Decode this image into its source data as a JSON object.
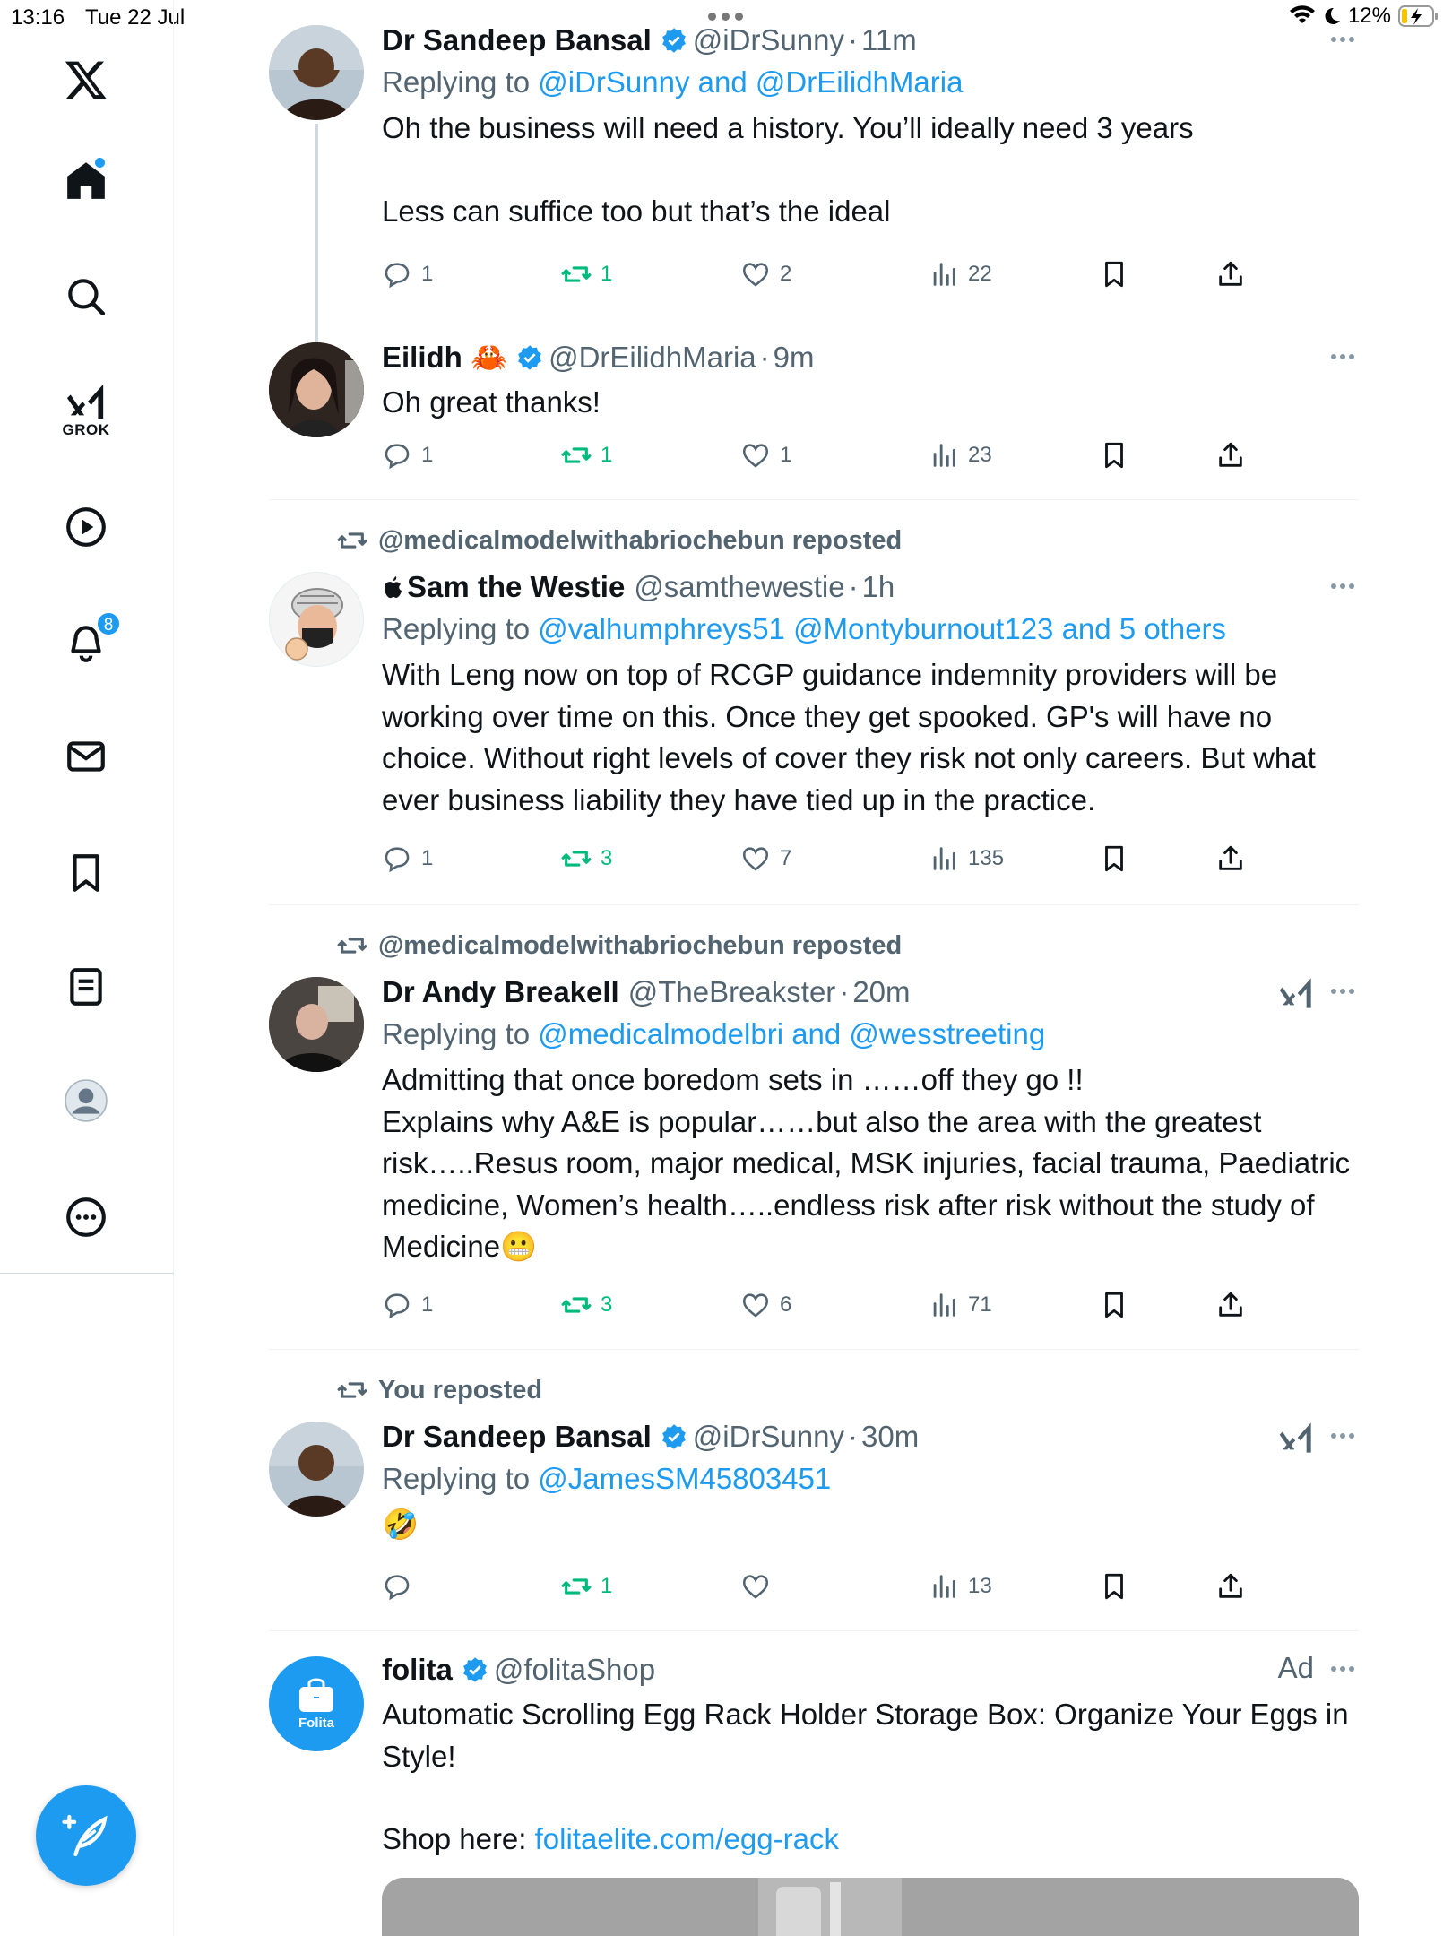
{
  "status_bar": {
    "time": "13:16",
    "date": "Tue 22 Jul",
    "battery": "12%"
  },
  "sidebar": {
    "grok_label": "GROK",
    "notifications_count": "8"
  },
  "tweets": [
    {
      "name": "Dr Sandeep Bansal",
      "handle": "@iDrSunny",
      "time": "11m",
      "replying_prefix": "Replying to ",
      "replying_to": "@iDrSunny and @DrEilidhMaria",
      "text_1": "Oh the business will need a history. You’ll ideally need 3 years",
      "text_2": "Less can suffice too but that’s the ideal",
      "replies": "1",
      "reposts": "1",
      "likes": "2",
      "views": "22"
    },
    {
      "name": "Eilidh 🦀",
      "handle": "@DrEilidhMaria",
      "time": "9m",
      "text_1": "Oh great thanks!",
      "replies": "1",
      "reposts": "1",
      "likes": "1",
      "views": "23"
    },
    {
      "reposted_by": "@medicalmodelwithabriochebun reposted",
      "name": " Sam the Westie",
      "handle": "@samthewestie",
      "time": "1h",
      "replying_prefix": "Replying to ",
      "replying_to": "@valhumphreys51 @Montyburnout123 and 5 others",
      "text_1": "With Leng now on top of RCGP guidance indemnity providers will be working over time on this. Once they get spooked. GP's will have no choice. Without right levels of cover they risk not only careers. But what ever business liability they have tied up in the practice.",
      "replies": "1",
      "reposts": "3",
      "likes": "7",
      "views": "135"
    },
    {
      "reposted_by": "@medicalmodelwithabriochebun reposted",
      "name": "Dr Andy Breakell",
      "handle": "@TheBreakster",
      "time": "20m",
      "replying_prefix": "Replying to ",
      "replying_to": "@medicalmodelbri and @wesstreeting",
      "text_1": "Admitting that once boredom sets in ……off they go !!",
      "text_2": "Explains why A&E is popular……but also the area with the greatest risk…..Resus room, major medical, MSK injuries, facial trauma, Paediatric medicine, Women’s health…..endless risk after risk without the study of Medicine😬",
      "replies": "1",
      "reposts": "3",
      "likes": "6",
      "views": "71"
    },
    {
      "reposted_by": "You reposted",
      "name": "Dr Sandeep Bansal",
      "handle": "@iDrSunny",
      "time": "30m",
      "replying_prefix": "Replying to ",
      "replying_to": "@JamesSM45803451",
      "text_1": "🤣",
      "replies": "",
      "reposts": "1",
      "likes": "",
      "views": "13"
    },
    {
      "name": "folita",
      "handle": "@folitaShop",
      "ad_label": "Ad",
      "avatar_text": "Folita",
      "text_1": "Automatic Scrolling Egg Rack Holder Storage Box: Organize Your Eggs in Style!",
      "shop_prefix": "Shop here: ",
      "shop_link": "folitaelite.com/egg-rack"
    }
  ],
  "colors": {
    "accent": "#1d9bf0",
    "repost_green": "#00ba7c",
    "secondary_text": "#536471"
  }
}
